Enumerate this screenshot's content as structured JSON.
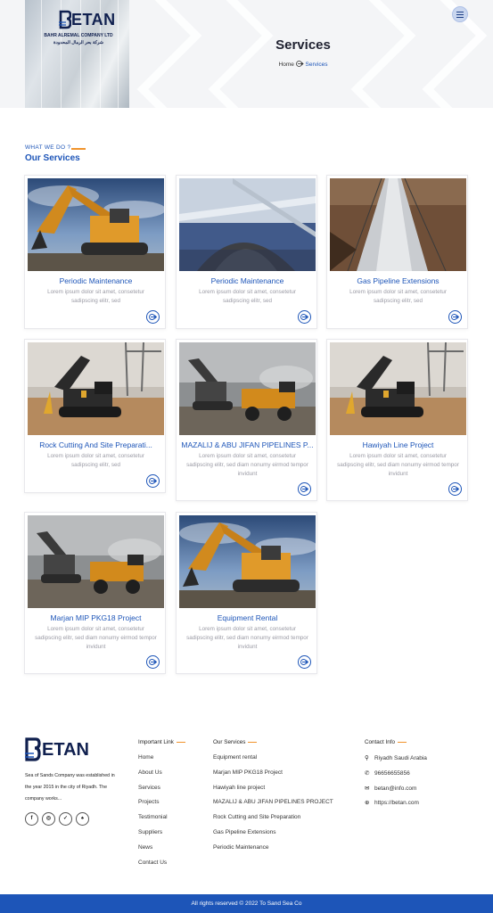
{
  "hero": {
    "logo_text": "ETAN",
    "company_en": "BAHR ALREMAL COMPANY LTD",
    "company_ar": "شركة بحر الرمال المحدودة",
    "title": "Services",
    "breadcrumb_home": "Home",
    "breadcrumb_current": "Services",
    "menu_icon": "hamburger-icon"
  },
  "section": {
    "kicker": "WHAT WE DO ?",
    "title": "Our Services"
  },
  "services": [
    {
      "title": "Periodic Maintenance",
      "desc": "Lorem ipsum dolor sit amet, consetetur sadipscing elitr, sed",
      "image": "excavator-sky"
    },
    {
      "title": "Periodic Maintenance",
      "desc": "Lorem ipsum dolor sit amet, consetetur sadipscing elitr, sed",
      "image": "conveyor-gravel"
    },
    {
      "title": "Gas Pipeline Extensions",
      "desc": "Lorem ipsum dolor sit amet, consetetur sadipscing elitr, sed",
      "image": "pipeline"
    },
    {
      "title": "Rock Cutting And Site Preparati...",
      "desc": "Lorem ipsum dolor sit amet, consetetur sadipscing elitr, sed",
      "image": "excavator-hammer"
    },
    {
      "title": "MAZALIJ & ABU JIFAN PIPELINES P...",
      "desc": "Lorem ipsum dolor sit amet, consetetur sadipscing elitr, sed diam nonumy eirmod tempor invidunt",
      "image": "mining-truck"
    },
    {
      "title": "Hawiyah Line Project",
      "desc": "Lorem ipsum dolor sit amet, consetetur sadipscing elitr, sed diam nonumy eirmod tempor invidunt",
      "image": "excavator-hammer"
    },
    {
      "title": "Marjan MIP PKG18 Project",
      "desc": "Lorem ipsum dolor sit amet, consetetur sadipscing elitr, sed diam nonumy eirmod tempor invidunt",
      "image": "mining-truck"
    },
    {
      "title": "Equipment Rental",
      "desc": "Lorem ipsum dolor sit amet, consetetur sadipscing elitr, sed diam nonumy eirmod tempor invidunt",
      "image": "excavator-sky"
    }
  ],
  "footer": {
    "logo_text": "ETAN",
    "about": "Sea of Sands Company was established in the year 2015 in the city of Riyadh. The company works...",
    "socials": [
      "facebook-icon",
      "instagram-icon",
      "twitter-icon",
      "snapchat-icon"
    ],
    "important_heading": "Important Link",
    "important_links": [
      "Home",
      "About Us",
      "Services",
      "Projects",
      "Testimonial",
      "Suppliers",
      "News",
      "Contact Us"
    ],
    "services_heading": "Our Services",
    "service_links": [
      "Equipment rental",
      "Marjan MIP PKG18 Project",
      "Hawiyah line project",
      "MAZALIJ & ABU JIFAN PIPELINES PROJECT",
      "Rock Cutting and Site Preparation",
      "Gas Pipeline Extensions",
      "Periodic Maintenance"
    ],
    "contact_heading": "Contact Info",
    "contacts": [
      {
        "icon": "location-icon",
        "text": "Riyadh Saudi Arabia"
      },
      {
        "icon": "phone-icon",
        "text": "96656655856"
      },
      {
        "icon": "mail-icon",
        "text": "betan@info.com"
      },
      {
        "icon": "globe-icon",
        "text": "https://betan.com"
      }
    ],
    "copyright": "All rights reserved © 2022 To Sand Sea Co"
  },
  "colors": {
    "brand_blue": "#1d55b8",
    "accent_orange": "#f0932b",
    "navy": "#10204f"
  }
}
